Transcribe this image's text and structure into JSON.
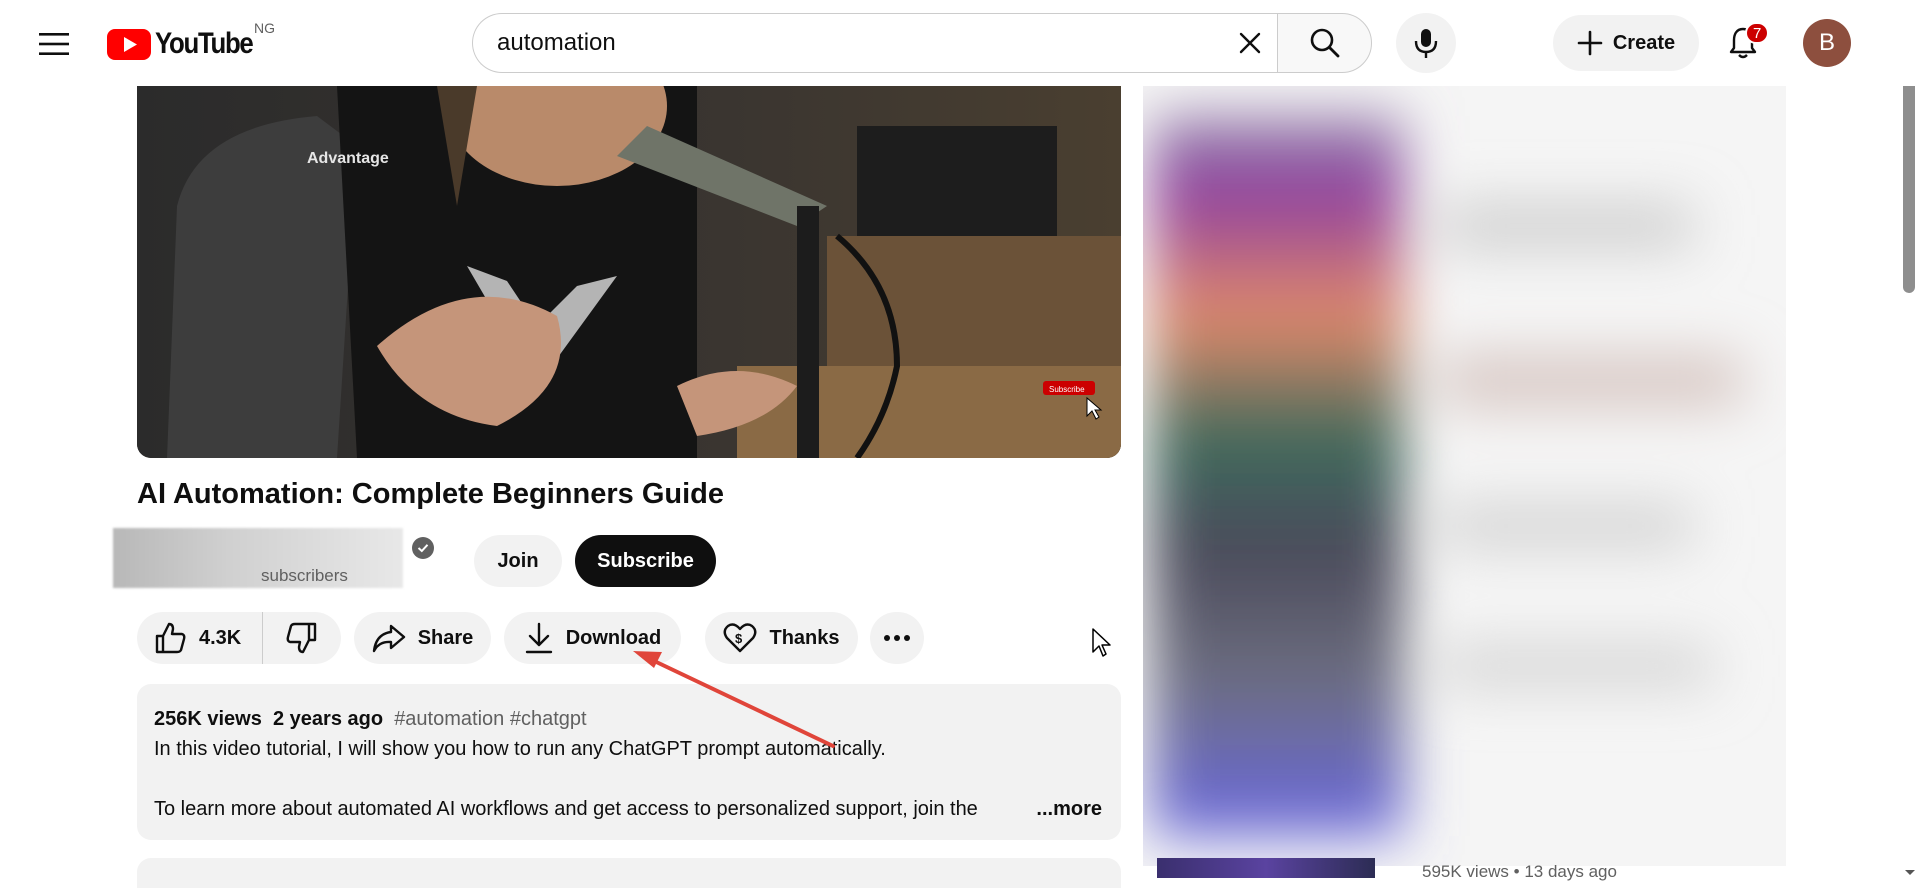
{
  "header": {
    "menu_icon": "hamburger-icon",
    "logo_text": "YouTube",
    "country_code": "NG",
    "search": {
      "value": "automation",
      "placeholder": "Search"
    },
    "create_label": "Create",
    "notification_count": "7",
    "avatar_letter": "B"
  },
  "video": {
    "title": "AI Automation: Complete Beginners Guide",
    "overlay_text": "Subscribe",
    "chair_brand": "Advantage"
  },
  "channel": {
    "subscribers_label": "subscribers",
    "join_label": "Join",
    "subscribe_label": "Subscribe"
  },
  "actions": {
    "like_count": "4.3K",
    "share_label": "Share",
    "download_label": "Download",
    "thanks_label": "Thanks"
  },
  "description": {
    "views": "256K views",
    "age": "2 years ago",
    "tags": "#automation #chatgpt",
    "line1": "In this video tutorial, I will show you how to run any ChatGPT prompt automatically.",
    "line2": "To learn more about automated AI workflows and get access to personalized support, join the",
    "more_label": "...more"
  },
  "sidebar": {
    "bottom_meta": "595K views • 13 days ago"
  },
  "colors": {
    "brand_red": "#ff0000",
    "annotation_arrow": "#e0453a",
    "subscribe_bg": "#0f0f0f"
  }
}
